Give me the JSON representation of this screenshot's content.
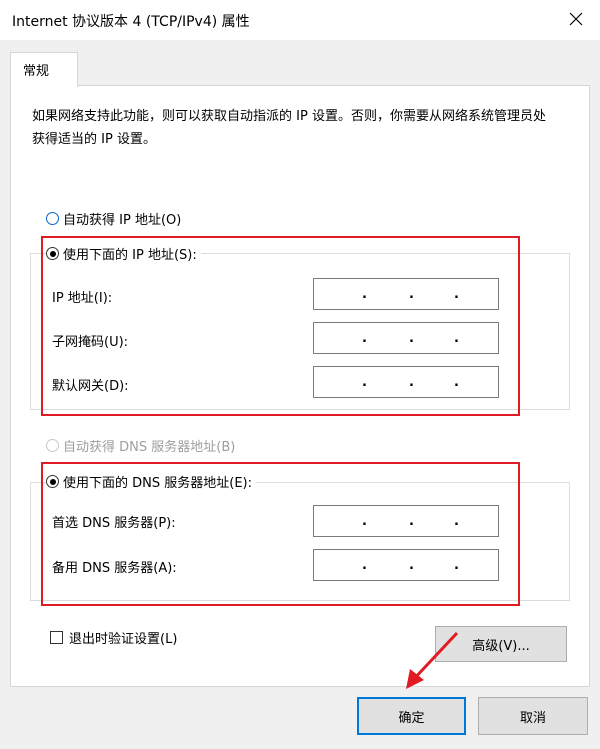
{
  "window": {
    "title": "Internet 协议版本 4 (TCP/IPv4) 属性"
  },
  "tabs": [
    {
      "label": "常规"
    }
  ],
  "description": "如果网络支持此功能，则可以获取自动指派的 IP 设置。否则，你需要从网络系统管理员处获得适当的 IP 设置。",
  "ip": {
    "auto_label": "自动获得 IP 地址(O)",
    "manual_label": "使用下面的 IP 地址(S):",
    "selected": "manual",
    "fields": [
      {
        "label": "IP 地址(I):",
        "value": ""
      },
      {
        "label": "子网掩码(U):",
        "value": ""
      },
      {
        "label": "默认网关(D):",
        "value": ""
      }
    ]
  },
  "dns": {
    "auto_label": "自动获得 DNS 服务器地址(B)",
    "manual_label": "使用下面的 DNS 服务器地址(E):",
    "selected": "manual",
    "fields": [
      {
        "label": "首选 DNS 服务器(P):",
        "value": ""
      },
      {
        "label": "备用 DNS 服务器(A):",
        "value": ""
      }
    ]
  },
  "validate_label": "退出时验证设置(L)",
  "validate_checked": false,
  "buttons": {
    "advanced": "高级(V)...",
    "ok": "确定",
    "cancel": "取消"
  },
  "colors": {
    "highlight_box": "#e01b24",
    "default_button_border": "#0078d7"
  },
  "icons": {
    "close": "close-icon",
    "annotation": "red-arrow-icon"
  }
}
